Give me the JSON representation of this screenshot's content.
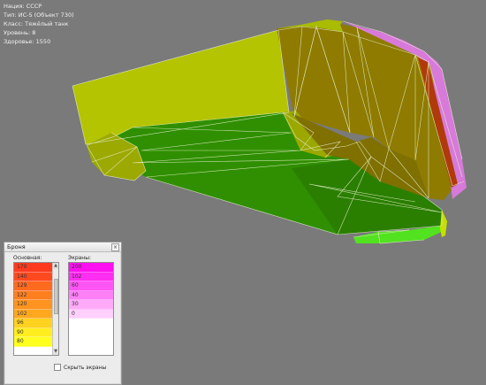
{
  "info": {
    "nation": "Нация: СССР",
    "type": "Тип: ИС-5 (Объект 730)",
    "class": "Класс: Тяжёлый танк",
    "tier": "Уровень: 8",
    "health": "Здоровье: 1550"
  },
  "armor_panel": {
    "title": "Броня",
    "close_icon": "close-icon",
    "base_label": "Основная:",
    "screens_label": "Экраны:",
    "base_rows": [
      {
        "value": "170",
        "color": "#ff3b1f"
      },
      {
        "value": "140",
        "color": "#ff4a1f"
      },
      {
        "value": "129",
        "color": "#ff6a1f"
      },
      {
        "value": "122",
        "color": "#ff7f1f"
      },
      {
        "value": "120",
        "color": "#ff931f"
      },
      {
        "value": "102",
        "color": "#ffa81f"
      },
      {
        "value": "96",
        "color": "#ffd21f"
      },
      {
        "value": "90",
        "color": "#ffee1f"
      },
      {
        "value": "80",
        "color": "#ffff1f"
      }
    ],
    "screen_rows": [
      {
        "value": "200",
        "color": "#ff10f0"
      },
      {
        "value": "102",
        "color": "#ff2ef2"
      },
      {
        "value": "60",
        "color": "#ff55f4"
      },
      {
        "value": "40",
        "color": "#ff80f6"
      },
      {
        "value": "30",
        "color": "#ffaaf8"
      },
      {
        "value": "0",
        "color": "#ffd0fb"
      },
      {
        "value": "",
        "color": "#ffffff"
      }
    ],
    "hide_screens_label": "Скрыть экраны",
    "hide_screens_checked": false
  },
  "colors": {
    "background": "#7a7a7a",
    "hull_yellow": "#b4c400",
    "hull_olive": "#8e7b00",
    "hull_green": "#2f8f00",
    "bright_green": "#52e21f",
    "screen_pink": "#d77ad9"
  }
}
